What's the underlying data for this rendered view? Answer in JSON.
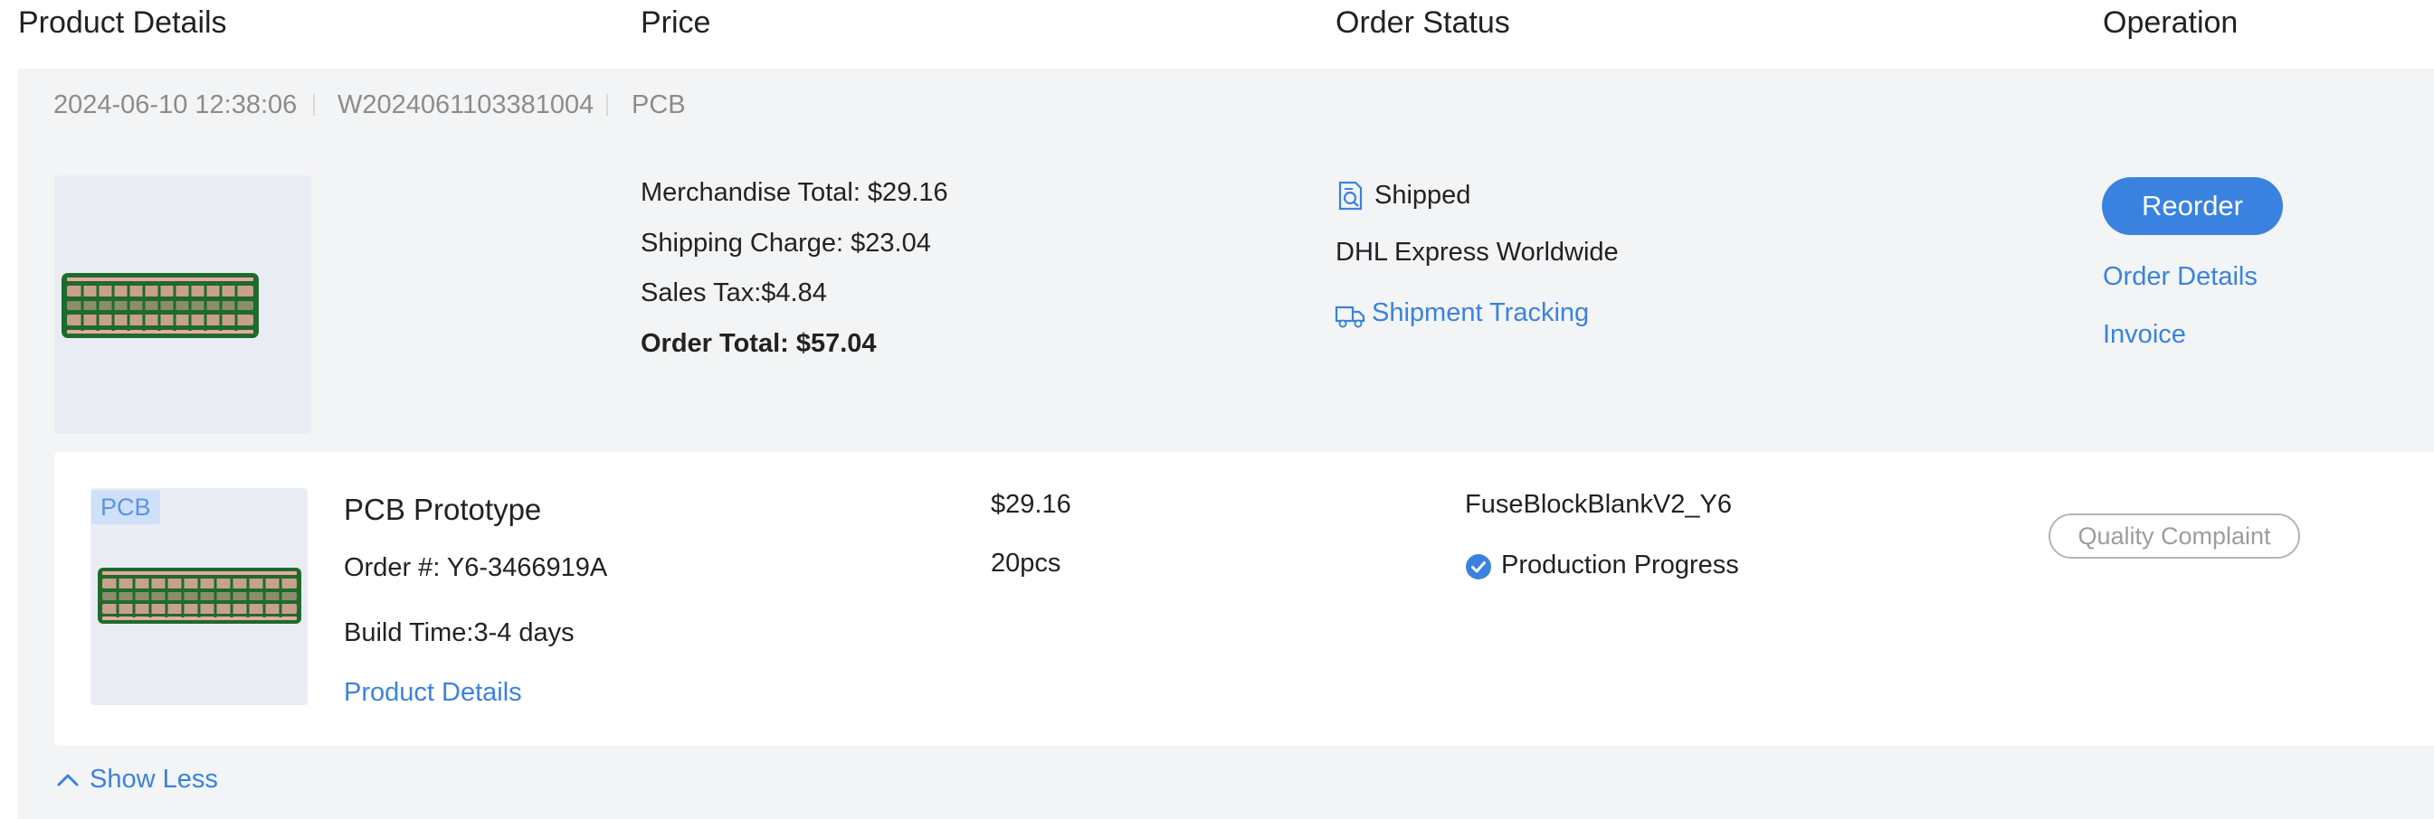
{
  "columns": {
    "product_details": "Product Details",
    "price": "Price",
    "order_status": "Order Status",
    "operation": "Operation"
  },
  "order": {
    "datetime": "2024-06-10 12:38:06",
    "order_no": "W2024061103381004",
    "category": "PCB",
    "price": {
      "merchandise_total": "Merchandise Total: $29.16",
      "shipping_charge": "Shipping Charge: $23.04",
      "sales_tax": "Sales Tax:$4.84",
      "order_total": "Order Total: $57.04"
    },
    "status": {
      "state": "Shipped",
      "carrier": "DHL Express Worldwide",
      "tracking_link": "Shipment Tracking"
    },
    "operation": {
      "reorder": "Reorder",
      "order_details": "Order Details",
      "invoice": "Invoice"
    }
  },
  "item": {
    "badge": "PCB",
    "name": "PCB Prototype",
    "order_number": "Order #: Y6-3466919A",
    "build_time": "Build Time:3-4 days",
    "details_link": "Product Details",
    "price": "$29.16",
    "quantity": "20pcs",
    "file_name": "FuseBlockBlankV2_Y6",
    "progress_link": "Production Progress",
    "quality_complaint": "Quality Complaint"
  },
  "show_less": "Show Less",
  "colors": {
    "accent": "#3a82e0",
    "panel_bg": "#f3f4f6",
    "pcb_green": "#1e6b2c",
    "pad_pink": "#e6a9a0"
  }
}
